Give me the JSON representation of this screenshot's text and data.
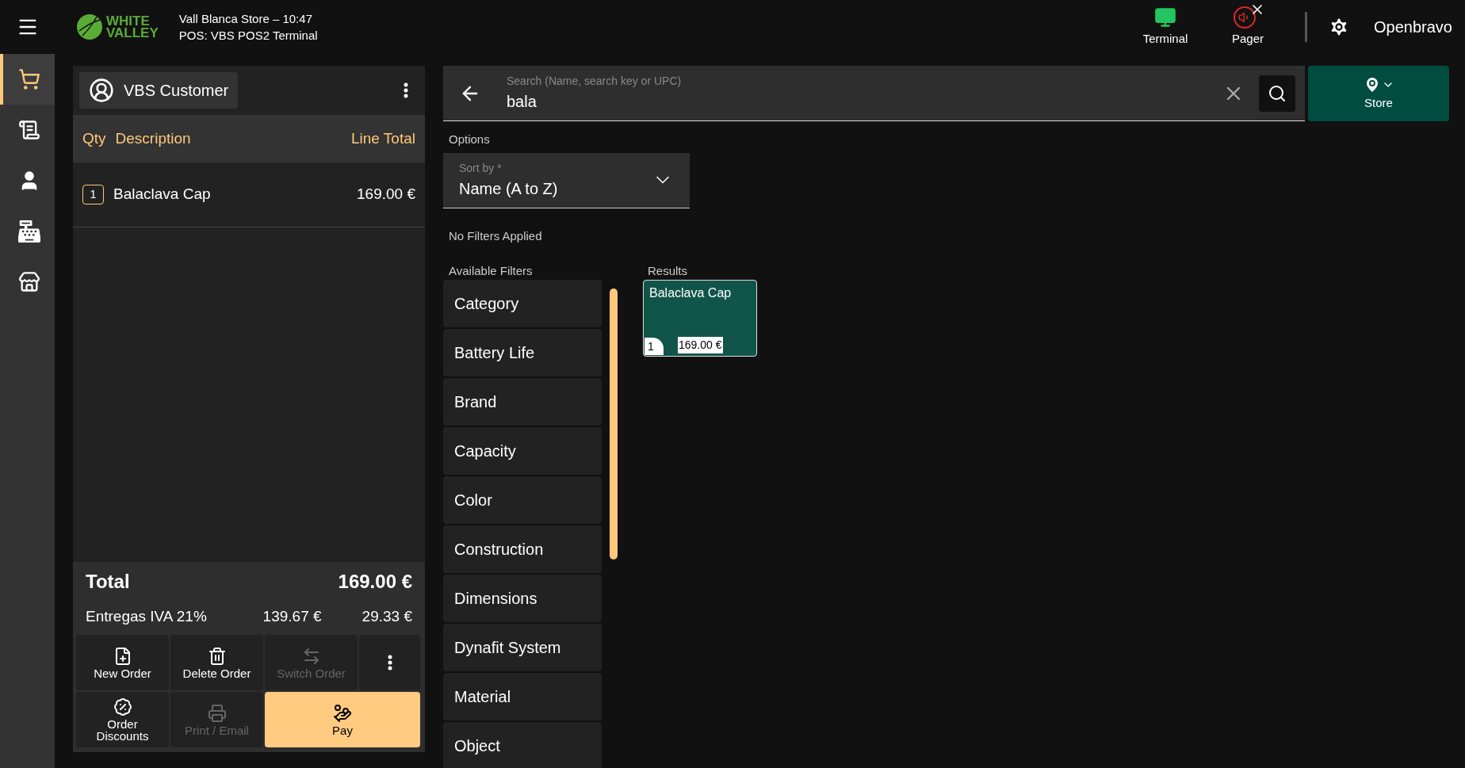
{
  "header": {
    "logo": [
      "WHITE",
      "VALLEY"
    ],
    "store_line": "Vall Blanca Store – 10:47",
    "terminal_line": "POS: VBS POS2 Terminal",
    "status_tools": [
      {
        "label": "Terminal",
        "kind": "terminal",
        "on": true
      },
      {
        "label": "Pager",
        "kind": "pager",
        "on": false
      }
    ],
    "user": "Openbravo"
  },
  "sidebar": {
    "items": [
      {
        "kind": "cart",
        "selected": true
      },
      {
        "kind": "receipts",
        "selected": false
      },
      {
        "kind": "customer",
        "selected": false
      },
      {
        "kind": "cash",
        "selected": false
      },
      {
        "kind": "store",
        "selected": false
      }
    ]
  },
  "order": {
    "customer": "VBS Customer",
    "columns": [
      "Qty",
      "Description",
      "Line Total"
    ],
    "lines": [
      {
        "qty": "1",
        "description": "Balaclava Cap",
        "total": "169.00 €"
      }
    ],
    "total_label": "Total",
    "total_value": "169.00 €",
    "taxes": [
      {
        "name": "Entregas IVA 21%",
        "base": "139.67 €",
        "amount": "29.33 €"
      }
    ],
    "actions": [
      {
        "kind": "new",
        "label": "New Order",
        "disabled": false
      },
      {
        "kind": "delete",
        "label": "Delete Order",
        "disabled": false
      },
      {
        "kind": "switch",
        "label": "Switch Order",
        "disabled": true
      },
      {
        "kind": "more",
        "disabled": false
      },
      {
        "kind": "discounts",
        "label": "Order Discounts",
        "disabled": false
      },
      {
        "kind": "print",
        "label": "Print / Email",
        "disabled": true
      },
      {
        "kind": "pay",
        "label": "Pay",
        "disabled": false
      }
    ]
  },
  "search": {
    "label": "Search (Name, search key or UPC)",
    "value": "bala",
    "store_button": "Store"
  },
  "options": {
    "title": "Options",
    "sort_label": "Sort by *",
    "sort_value": "Name (A to Z)",
    "filters_status": "No Filters Applied"
  },
  "filters": {
    "title": "Available Filters",
    "items": [
      "Category",
      "Battery Life",
      "Brand",
      "Capacity",
      "Color",
      "Construction",
      "Dimensions",
      "Dynafit System",
      "Material",
      "Object"
    ]
  },
  "results": {
    "title": "Results",
    "items": [
      {
        "name": "Balaclava Cap",
        "qty": "1",
        "price": "169.00 €"
      }
    ]
  }
}
